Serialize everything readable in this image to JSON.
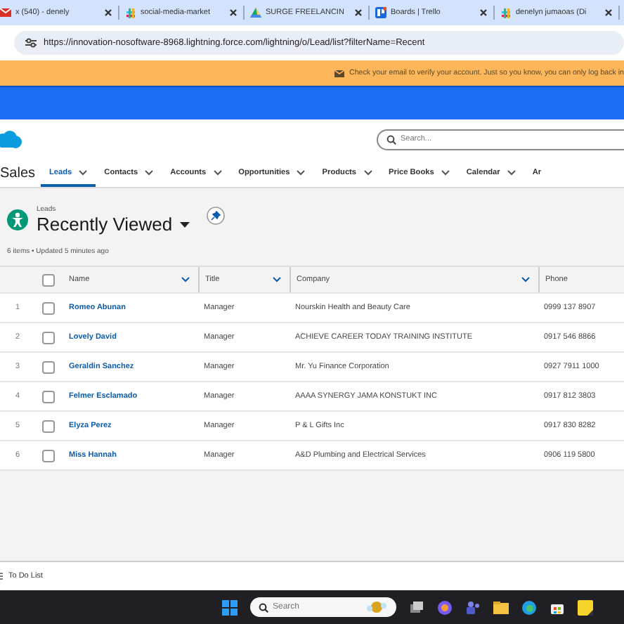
{
  "browser": {
    "tabs": [
      {
        "title": "x (540) - denely"
      },
      {
        "title": "social-media-market"
      },
      {
        "title": "SURGE FREELANCIN"
      },
      {
        "title": "Boards | Trello"
      },
      {
        "title": "denelyn jumaoas (Di"
      }
    ],
    "url": "https://innovation-nosoftware-8968.lightning.force.com/lightning/o/Lead/list?filterName=Recent"
  },
  "banner": {
    "message": "Check your email to verify your account. Just so you know, you can only log back in"
  },
  "header": {
    "search": {
      "placeholder": "Search..."
    },
    "app_name": "Sales",
    "nav": [
      {
        "label": "Leads",
        "selected": true
      },
      {
        "label": "Contacts",
        "selected": false
      },
      {
        "label": "Accounts",
        "selected": false
      },
      {
        "label": "Opportunities",
        "selected": false
      },
      {
        "label": "Products",
        "selected": false
      },
      {
        "label": "Price Books",
        "selected": false
      },
      {
        "label": "Calendar",
        "selected": false
      },
      {
        "label": "Ar",
        "selected": false
      }
    ]
  },
  "list_view": {
    "object": "Leads",
    "title": "Recently Viewed",
    "meta": "6 items • Updated 5 minutes ago",
    "select_all": {
      "checked": false
    },
    "columns": [
      {
        "label": "Name",
        "menu": true
      },
      {
        "label": "Title",
        "menu": true
      },
      {
        "label": "Company",
        "menu": true
      },
      {
        "label": "Phone",
        "menu": false
      }
    ],
    "rows": [
      {
        "number": "1",
        "name": "Romeo Abunan",
        "title": "Manager",
        "company": "Nourskin Health and Beauty Care",
        "phone": "0999 137 8907",
        "checked": false
      },
      {
        "number": "2",
        "name": "Lovely David",
        "title": "Manager",
        "company": "ACHIEVE CAREER TODAY TRAINING INSTITUTE",
        "phone": "0917 546 8866",
        "checked": false
      },
      {
        "number": "3",
        "name": "Geraldin Sanchez",
        "title": "Manager",
        "company": "Mr. Yu Finance Corporation",
        "phone": "0927 7911 1000",
        "checked": false
      },
      {
        "number": "4",
        "name": "Felmer Esclamado",
        "title": "Manager",
        "company": "AAAA SYNERGY JAMA KONSTUKT INC",
        "phone": "0917 812 3803",
        "checked": false
      },
      {
        "number": "5",
        "name": "Elyza Perez",
        "title": "Manager",
        "company": "P & L Gifts Inc",
        "phone": "0917 830 8282",
        "checked": false
      },
      {
        "number": "6",
        "name": "Miss Hannah",
        "title": "Manager",
        "company": "A&D Plumbing and Electrical Services",
        "phone": "0906 119 5800",
        "checked": false
      }
    ]
  },
  "utility_bar": {
    "items": [
      "To Do List"
    ]
  },
  "taskbar": {
    "search": {
      "placeholder": "Search"
    }
  }
}
